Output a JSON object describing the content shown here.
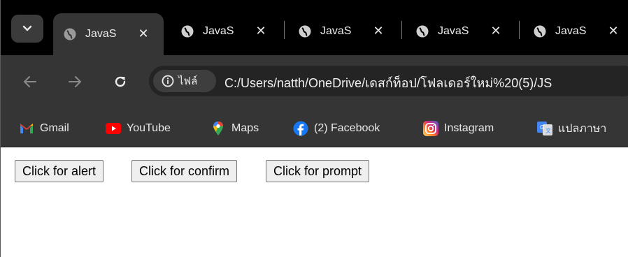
{
  "tabs": [
    {
      "title": "JavaS",
      "active": true
    },
    {
      "title": "JavaS",
      "active": false
    },
    {
      "title": "JavaS",
      "active": false
    },
    {
      "title": "JavaS",
      "active": false
    },
    {
      "title": "JavaS",
      "active": false
    }
  ],
  "toolbar": {
    "site_chip_label": "ไฟล์",
    "url": "C:/Users/natth/OneDrive/เดสก์ท็อป/โฟลเดอร์ใหม่%20(5)/JS"
  },
  "bookmarks": [
    {
      "label": "Gmail",
      "icon": "gmail-icon"
    },
    {
      "label": "YouTube",
      "icon": "youtube-icon"
    },
    {
      "label": "Maps",
      "icon": "maps-icon"
    },
    {
      "label": "(2) Facebook",
      "icon": "facebook-icon"
    },
    {
      "label": "Instagram",
      "icon": "instagram-icon"
    },
    {
      "label": "แปลภาษา",
      "icon": "translate-icon"
    }
  ],
  "page": {
    "alert_button": "Click for alert",
    "confirm_button": "Click for confirm",
    "prompt_button": "Click for prompt"
  },
  "colors": {
    "tabstrip": "#000000",
    "toolbar": "#353535",
    "omnibox": "#242424",
    "button_bg": "#efefef"
  }
}
